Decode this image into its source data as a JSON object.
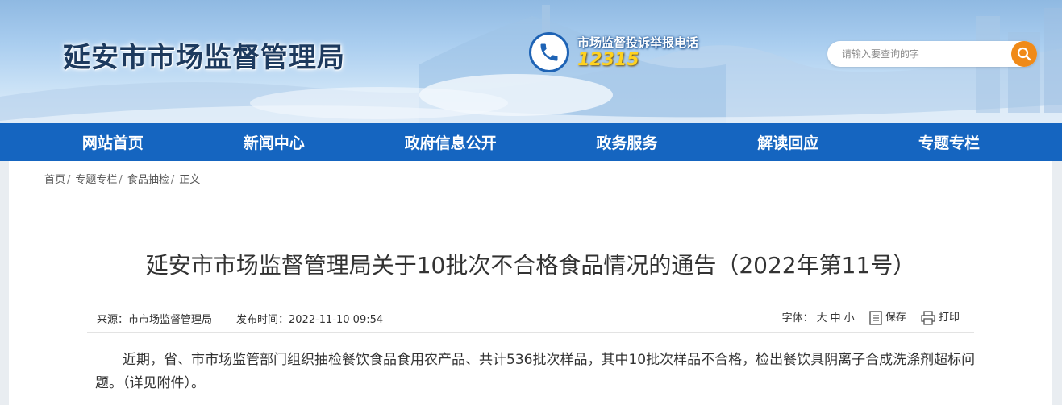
{
  "header": {
    "site_title": "延安市市场监督管理局",
    "hotline_label": "市场监督投诉举报电话",
    "hotline_number": "12315",
    "search_placeholder": "请输入要查询的字"
  },
  "nav": {
    "items": [
      {
        "label": "网站首页"
      },
      {
        "label": "新闻中心"
      },
      {
        "label": "政府信息公开"
      },
      {
        "label": "政务服务"
      },
      {
        "label": "解读回应"
      },
      {
        "label": "专题专栏"
      }
    ]
  },
  "breadcrumb": {
    "items": [
      "首页",
      "专题专栏",
      "食品抽检",
      "正文"
    ],
    "separator": "/"
  },
  "article": {
    "title": "延安市市场监督管理局关于10批次不合格食品情况的通告（2022年第11号）",
    "source": "来源：市市场监督管理局",
    "publish_time": "发布时间：2022-11-10 09:54",
    "font_size_label": "字体：",
    "font_size_large": "大",
    "font_size_medium": "中",
    "font_size_small": "小",
    "save_label": "保存",
    "print_label": "打印",
    "paragraph": "近期，省、市市场监管部门组织抽检餐饮食品食用农产品、共计536批次样品，其中10批次样品不合格，检出餐饮具阴离子合成洗涤剂超标问题。（详见附件）。"
  },
  "colors": {
    "nav_background": "#1565c0",
    "hotline_number": "#ffd21f",
    "search_button": "#f08a18",
    "title_text": "#333333"
  },
  "icons": [
    "phone-icon",
    "search-icon",
    "save-icon",
    "print-icon"
  ]
}
